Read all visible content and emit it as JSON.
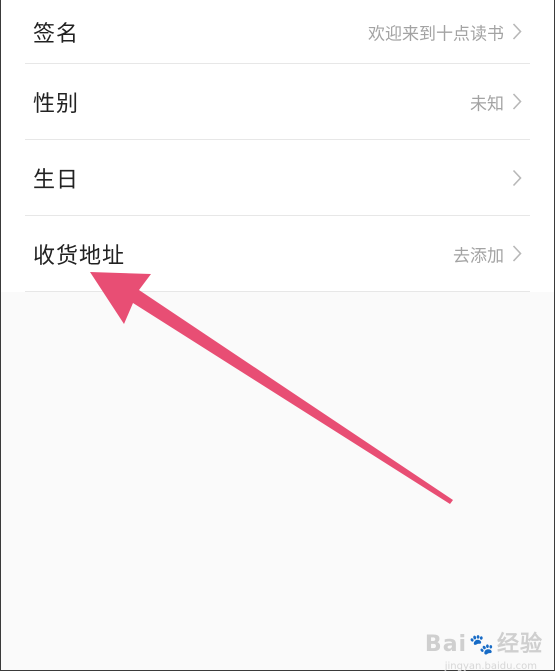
{
  "rows": [
    {
      "label": "签名",
      "value": "欢迎来到十点读书"
    },
    {
      "label": "性别",
      "value": "未知"
    },
    {
      "label": "生日",
      "value": ""
    },
    {
      "label": "收货地址",
      "value": "去添加"
    }
  ],
  "annotation": {
    "arrow_color": "#e84e74",
    "icon": "arrow-annotation"
  },
  "watermark": {
    "brand_part1": "Bai",
    "brand_part2": "经验",
    "paw_icon": "paw-icon",
    "url": "jingyan.baidu.com"
  }
}
